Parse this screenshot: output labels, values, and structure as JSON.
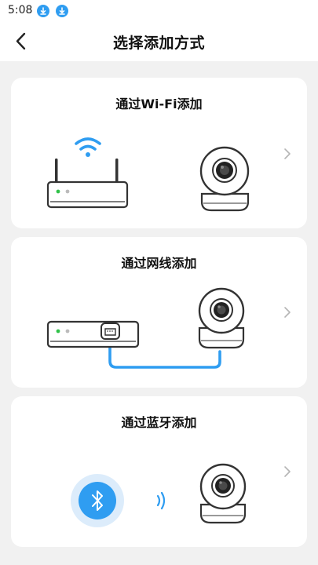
{
  "status_bar": {
    "time": "5:08",
    "icons": [
      "download-icon",
      "download-icon"
    ]
  },
  "header": {
    "back_icon": "back-arrow-icon",
    "title": "选择添加方式"
  },
  "methods": [
    {
      "title": "通过Wi-Fi添加",
      "illustration": "wifi-router-camera",
      "chevron": "chevron-right-icon"
    },
    {
      "title": "通过网线添加",
      "illustration": "ethernet-cable-camera",
      "chevron": "chevron-right-icon"
    },
    {
      "title": "通过蓝牙添加",
      "illustration": "bluetooth-camera",
      "chevron": "chevron-right-icon"
    }
  ],
  "colors": {
    "accent_blue": "#2f9df1",
    "background": "#f1f1f1",
    "card": "#ffffff",
    "led_green": "#31c24a"
  }
}
